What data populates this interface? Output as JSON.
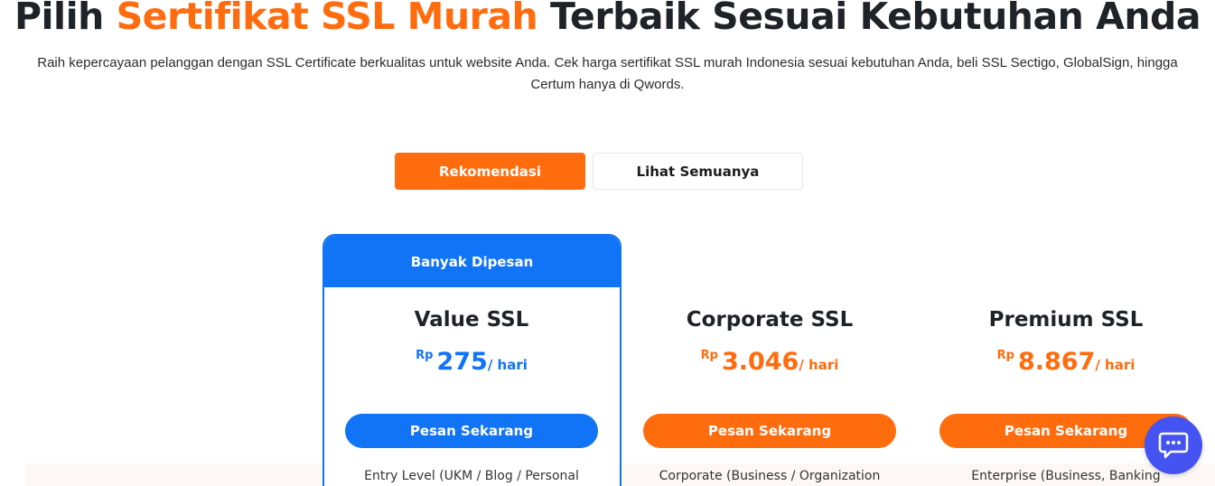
{
  "header": {
    "title_part1": "Pilih",
    "title_accent": "Sertifikat SSL Murah",
    "title_part2": "Terbaik Sesuai Kebutuhan Anda",
    "subtitle": "Raih kepercayaan pelanggan dengan SSL Certificate berkualitas untuk website Anda. Cek harga sertifikat SSL murah Indonesia sesuai kebutuhan Anda, beli SSL Sectigo, GlobalSign, hingga Certum hanya di Qwords."
  },
  "tabs": [
    {
      "label": "Rekomendasi",
      "active": true
    },
    {
      "label": "Lihat Semuanya",
      "active": false
    }
  ],
  "popular_badge": "Banyak Dipesan",
  "plans": [
    {
      "name": "Value SSL",
      "currency": "Rp",
      "price": "275",
      "per": "/ hari",
      "button": "Pesan Sekarang",
      "desc": "Entry Level (UKM / Blog / Personal",
      "accent": "#1173f5"
    },
    {
      "name": "Corporate SSL",
      "currency": "Rp",
      "price": "3.046",
      "per": "/ hari",
      "button": "Pesan Sekarang",
      "desc": "Corporate (Business / Organization",
      "accent": "#ff6c0e"
    },
    {
      "name": "Premium SSL",
      "currency": "Rp",
      "price": "8.867",
      "per": "/ hari",
      "button": "Pesan Sekarang",
      "desc": "Enterprise (Business, Banking",
      "accent": "#ff6c0e"
    }
  ],
  "chat": {
    "icon": "chat-bubble-icon",
    "color": "#4453f2"
  },
  "colors": {
    "brand_orange": "#ff6c0e",
    "brand_blue": "#1173f5"
  }
}
